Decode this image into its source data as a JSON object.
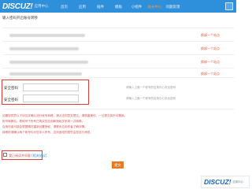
{
  "header": {
    "logo_mark": "DISCUZ!",
    "logo_sub": "应用中心",
    "nav": [
      "首页",
      "应用",
      "插件",
      "模板",
      "小组件",
      "站长中心",
      "问题反馈"
    ],
    "active_index": 5
  },
  "section": {
    "title": "输入密码开启账号转移"
  },
  "rows": [
    {
      "link": "换绑一个站点"
    },
    {
      "link": "换绑一个站点"
    },
    {
      "link": "换绑一个站点"
    },
    {
      "link": "换绑一个站点"
    }
  ],
  "form": {
    "label1": "安全密码",
    "label2": "安全密码",
    "hint1": "请输入上面一个帐号的应用中心安全密码",
    "hint2": "请输入上面一个帐号的应用中心安全密码",
    "value1": "",
    "value2": ""
  },
  "notice": {
    "lines": [
      "如果您同意以下协议并确认进行帐号转移，请点击同意并提交。请慎重操作，一旦提交将不可撤销。",
      "帐号转移后，原帐号下所有已购买的应用和授权关系将一并转移。",
      "应用作者可能会根据情况重新设置授权，请联系应用作者了解详情。",
      "转移前请确认两个帐号均为您本人所有，否则造成的损失由您自行承担。"
    ],
    "agree_prefix": "我已阅读并同意",
    "agree_link": "[相关协议]"
  },
  "submit_label": "提交",
  "watermark": {
    "mark": "DISCUZ!",
    "sub": "应用中心"
  }
}
